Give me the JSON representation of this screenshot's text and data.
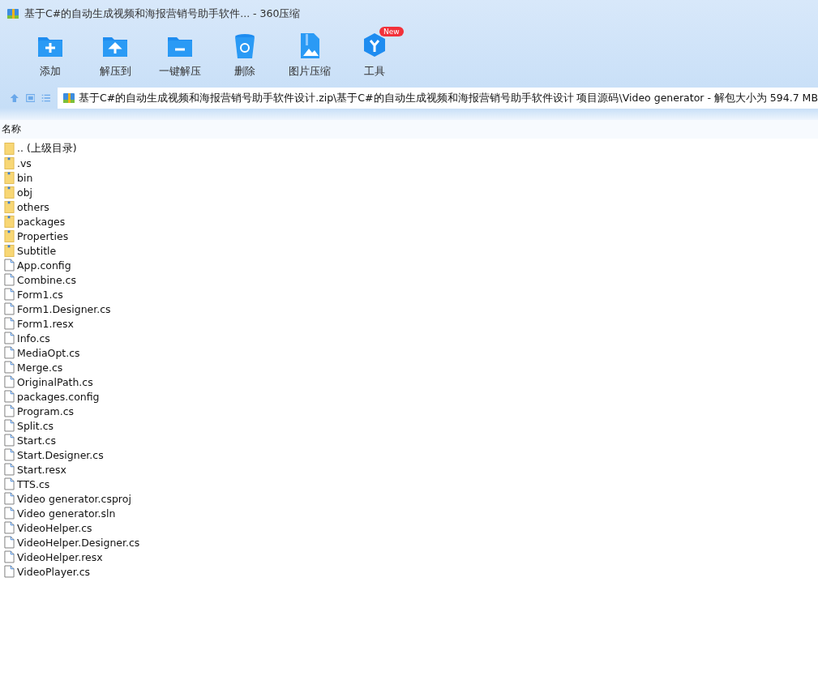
{
  "window": {
    "title": "基于C#的自动生成视频和海报营销号助手软件... - 360压缩"
  },
  "toolbar": [
    {
      "kind": "add",
      "label": "添加"
    },
    {
      "kind": "extract-to",
      "label": "解压到"
    },
    {
      "kind": "one-click",
      "label": "一键解压"
    },
    {
      "kind": "delete",
      "label": "删除"
    },
    {
      "kind": "image",
      "label": "图片压缩"
    },
    {
      "kind": "tools",
      "label": "工具",
      "badge": "New"
    }
  ],
  "address": {
    "path": "基于C#的自动生成视频和海报营销号助手软件设计.zip\\基于C#的自动生成视频和海报营销号助手软件设计 项目源码\\Video generator - 解包大小为 594.7 MB"
  },
  "table": {
    "columns": [
      "名称"
    ],
    "rows": [
      {
        "kind": "parent",
        "name": ".. (上级目录)"
      },
      {
        "kind": "folder",
        "name": ".vs"
      },
      {
        "kind": "folder",
        "name": "bin"
      },
      {
        "kind": "folder",
        "name": "obj"
      },
      {
        "kind": "folder",
        "name": "others"
      },
      {
        "kind": "folder",
        "name": "packages"
      },
      {
        "kind": "folder",
        "name": "Properties"
      },
      {
        "kind": "folder",
        "name": "Subtitle"
      },
      {
        "kind": "file",
        "name": "App.config"
      },
      {
        "kind": "file",
        "name": "Combine.cs"
      },
      {
        "kind": "file",
        "name": "Form1.cs"
      },
      {
        "kind": "file",
        "name": "Form1.Designer.cs"
      },
      {
        "kind": "file",
        "name": "Form1.resx"
      },
      {
        "kind": "file",
        "name": "Info.cs"
      },
      {
        "kind": "file",
        "name": "MediaOpt.cs"
      },
      {
        "kind": "file",
        "name": "Merge.cs"
      },
      {
        "kind": "file",
        "name": "OriginalPath.cs"
      },
      {
        "kind": "file",
        "name": "packages.config"
      },
      {
        "kind": "file",
        "name": "Program.cs"
      },
      {
        "kind": "file",
        "name": "Split.cs"
      },
      {
        "kind": "file",
        "name": "Start.cs"
      },
      {
        "kind": "file",
        "name": "Start.Designer.cs"
      },
      {
        "kind": "file",
        "name": "Start.resx"
      },
      {
        "kind": "file",
        "name": "TTS.cs"
      },
      {
        "kind": "file",
        "name": "Video generator.csproj"
      },
      {
        "kind": "file",
        "name": "Video generator.sln"
      },
      {
        "kind": "file",
        "name": "VideoHelper.cs"
      },
      {
        "kind": "file",
        "name": "VideoHelper.Designer.cs"
      },
      {
        "kind": "file",
        "name": "VideoHelper.resx"
      },
      {
        "kind": "file",
        "name": "VideoPlayer.cs"
      }
    ]
  }
}
